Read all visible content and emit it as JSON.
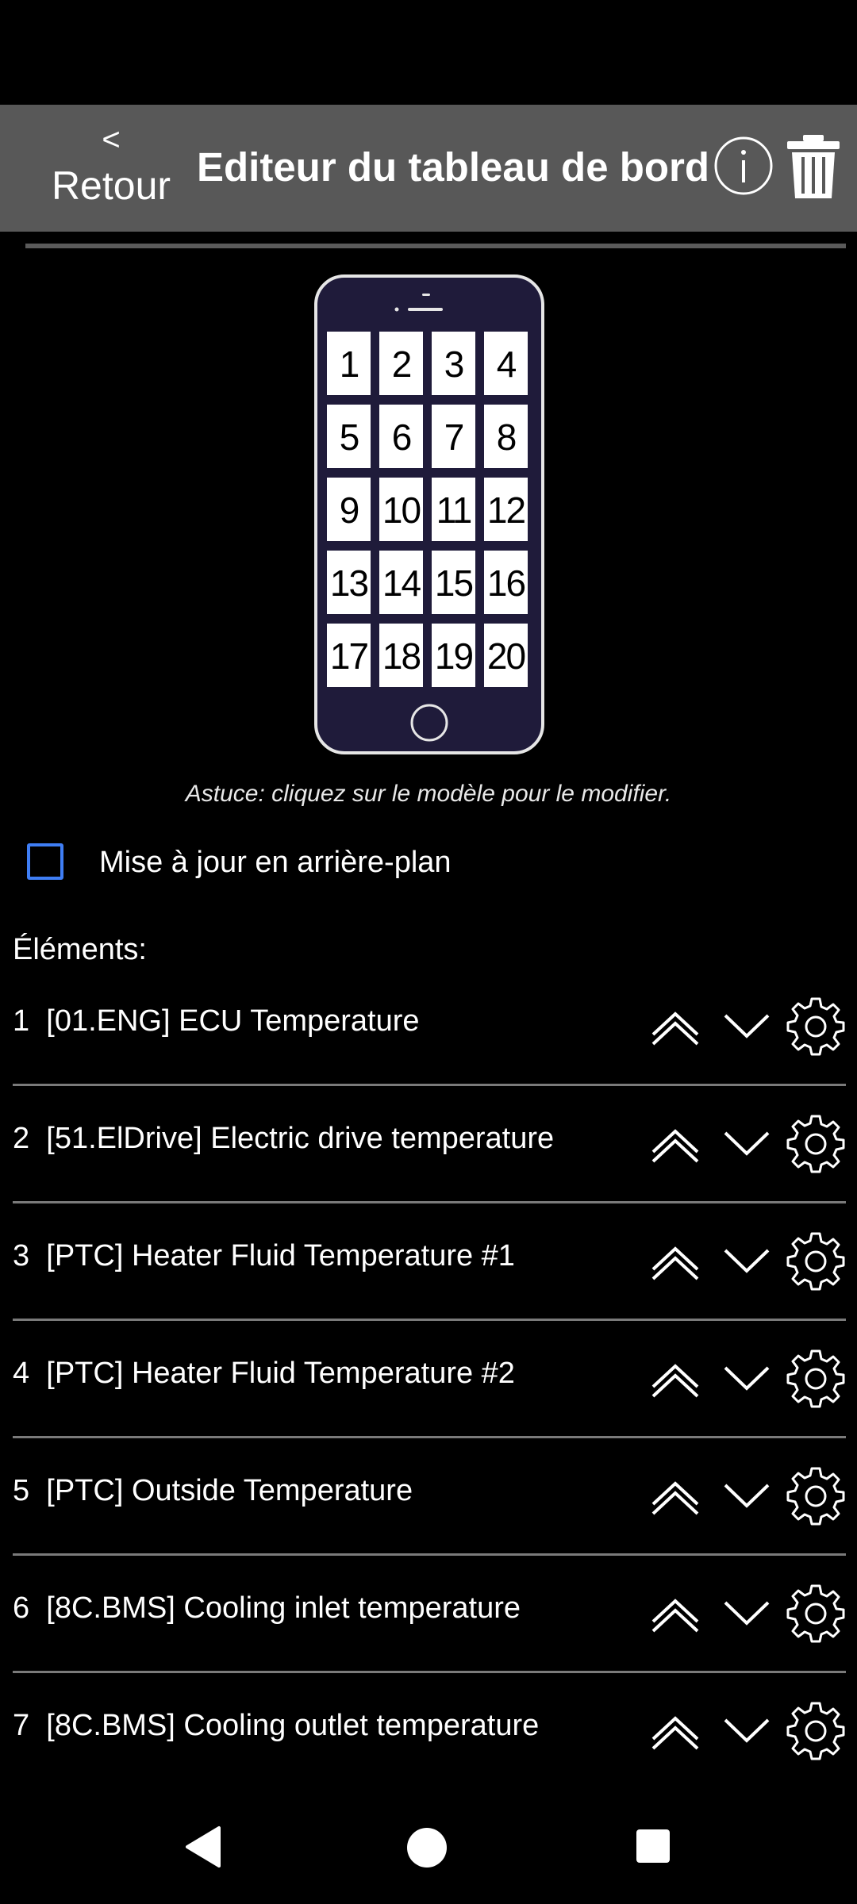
{
  "header": {
    "back_arrow": "<",
    "back_label": "Retour",
    "title": "Editeur du tableau de bord"
  },
  "icons": {
    "info": "info-icon",
    "trash": "trash-icon",
    "up": "chevron-up-icon",
    "down": "chevron-down-icon",
    "settings": "gear-icon"
  },
  "phone_model": {
    "cells": [
      "1",
      "2",
      "3",
      "4",
      "5",
      "6",
      "7",
      "8",
      "9",
      "10",
      "11",
      "12",
      "13",
      "14",
      "15",
      "16",
      "17",
      "18",
      "19",
      "20"
    ]
  },
  "tip": "Astuce: cliquez sur le modèle pour le modifier.",
  "background_update": {
    "label": "Mise à jour en arrière-plan",
    "checked": false
  },
  "elements": {
    "title": "Éléments:",
    "items": [
      {
        "num": "1",
        "label": "[01.ENG] ECU Temperature"
      },
      {
        "num": "2",
        "label": "[51.ElDrive] Electric drive temperature"
      },
      {
        "num": "3",
        "label": "[PTC] Heater Fluid Temperature #1"
      },
      {
        "num": "4",
        "label": "[PTC] Heater Fluid Temperature #2"
      },
      {
        "num": "5",
        "label": "[PTC] Outside Temperature"
      },
      {
        "num": "6",
        "label": "[8C.BMS] Cooling inlet temperature"
      },
      {
        "num": "7",
        "label": "[8C.BMS] Cooling outlet temperature"
      }
    ]
  },
  "colors": {
    "background": "#000000",
    "header": "#585858",
    "checkbox_border": "#3f7ef5",
    "phone_body": "#1f1b3a"
  }
}
